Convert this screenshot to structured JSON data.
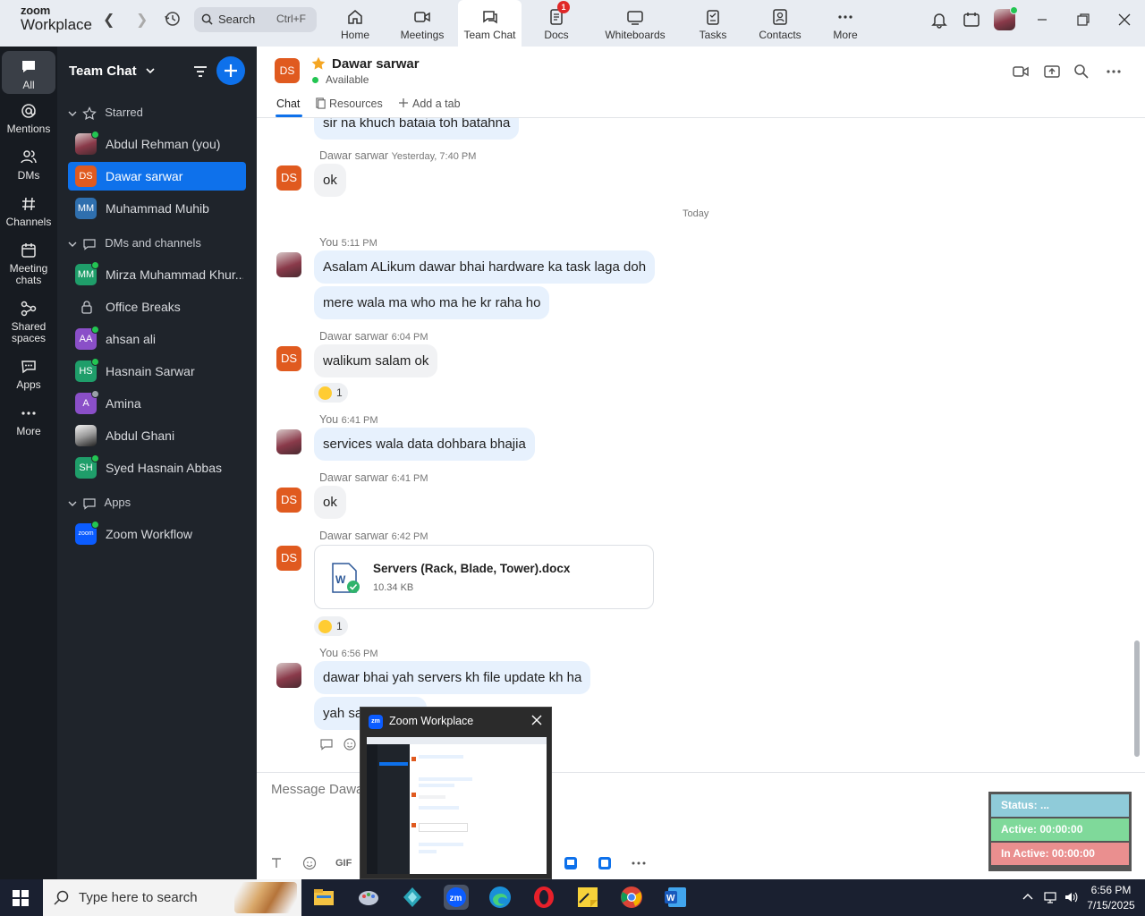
{
  "brand": {
    "line1": "zoom",
    "line2": "Workplace"
  },
  "search": {
    "label": "Search",
    "shortcut": "Ctrl+F"
  },
  "nav_tabs": [
    {
      "label": "Home",
      "icon": "home-icon"
    },
    {
      "label": "Meetings",
      "icon": "video-icon"
    },
    {
      "label": "Team Chat",
      "icon": "chat-icon",
      "active": true
    },
    {
      "label": "Docs",
      "icon": "docs-icon",
      "badge": "1"
    },
    {
      "label": "Whiteboards",
      "icon": "whiteboard-icon"
    },
    {
      "label": "Tasks",
      "icon": "tasks-icon"
    },
    {
      "label": "Contacts",
      "icon": "contacts-icon"
    },
    {
      "label": "More",
      "icon": "more-icon"
    }
  ],
  "rail": [
    {
      "label": "All",
      "icon": "chat-bubble-icon",
      "active": true
    },
    {
      "label": "Mentions",
      "icon": "at-icon"
    },
    {
      "label": "DMs",
      "icon": "people-icon"
    },
    {
      "label": "Channels",
      "icon": "hash-icon"
    },
    {
      "label": "Meeting chats",
      "icon": "calendar-icon"
    },
    {
      "label": "Shared spaces",
      "icon": "share-icon"
    },
    {
      "label": "Apps",
      "icon": "apps-icon"
    },
    {
      "label": "More",
      "icon": "ellipsis-icon"
    }
  ],
  "sidebar": {
    "title": "Team Chat",
    "sections": {
      "starred": "Starred",
      "dms": "DMs and channels",
      "apps": "Apps"
    },
    "starred": [
      {
        "name": "Abdul Rehman (you)",
        "avatar": "photo"
      },
      {
        "name": "Dawar sarwar",
        "initials": "DS",
        "color": "#e05a1f",
        "selected": true
      },
      {
        "name": "Muhammad Muhib",
        "initials": "MM",
        "color": "#2f6fae"
      }
    ],
    "dms": [
      {
        "name": "Mirza Muhammad Khur...",
        "initials": "MM",
        "color": "#1f9e6a"
      },
      {
        "name": "Office Breaks",
        "icon": "lock-icon"
      },
      {
        "name": "ahsan ali",
        "initials": "AA",
        "color": "#8a4fc8"
      },
      {
        "name": "Hasnain Sarwar",
        "initials": "HS",
        "color": "#1f9e6a"
      },
      {
        "name": "Amina",
        "initials": "A",
        "color": "#8a4fc8"
      },
      {
        "name": "Abdul Ghani",
        "avatar": "photo2"
      },
      {
        "name": "Syed Hasnain Abbas",
        "initials": "SH",
        "color": "#1f9e6a"
      }
    ],
    "apps": [
      {
        "name": "Zoom Workflow",
        "initials": "zoom",
        "color": "#0b5cff"
      }
    ]
  },
  "header": {
    "initials": "DS",
    "name": "Dawar sarwar",
    "status": "Available",
    "tabs": [
      "Chat",
      "Resources",
      "Add a tab"
    ]
  },
  "messages": {
    "top_partial": "sir na khuch bataia toh batahna",
    "blocks": [
      {
        "sender": "Dawar sarwar",
        "time": "Yesterday, 7:40 PM",
        "bubbles": [
          "ok"
        ]
      },
      {
        "sender": "You",
        "time": "5:11 PM",
        "bubbles": [
          "Asalam ALikum dawar bhai hardware ka task laga doh",
          "mere wala ma who ma he kr raha ho"
        ]
      },
      {
        "sender": "Dawar sarwar",
        "time": "6:04 PM",
        "bubbles": [
          "walikum salam ok"
        ],
        "reaction": "1"
      },
      {
        "sender": "You",
        "time": "6:41 PM",
        "bubbles": [
          "services wala data dohbara bhajia"
        ]
      },
      {
        "sender": "Dawar sarwar",
        "time": "6:41 PM",
        "bubbles": [
          "ok"
        ]
      },
      {
        "sender": "Dawar sarwar",
        "time": "6:42 PM",
        "file": {
          "name": "Servers (Rack, Blade, Tower).docx",
          "size": "10.34 KB"
        },
        "reaction": "1"
      },
      {
        "sender": "You",
        "time": "6:56 PM",
        "bubbles": [
          "dawar bhai yah servers kh file update kh ha",
          "yah sa"
        ]
      }
    ],
    "date_separator": "Today"
  },
  "composer": {
    "placeholder": "Message Dawa",
    "gif_label": "GIF"
  },
  "thumbnail_popup": {
    "title": "Zoom Workplace",
    "logo": "zm"
  },
  "status_widget": {
    "status": "Status: ...",
    "active": "Active: 00:00:00",
    "inactive": "In Active: 00:00:00"
  },
  "taskbar": {
    "search_placeholder": "Type here to search",
    "time": "6:56 PM",
    "date": "7/15/2025"
  },
  "colors": {
    "accent": "#0e71eb",
    "sidebar_bg": "#1f242b",
    "rail_bg": "#171b21",
    "online": "#23c552"
  }
}
